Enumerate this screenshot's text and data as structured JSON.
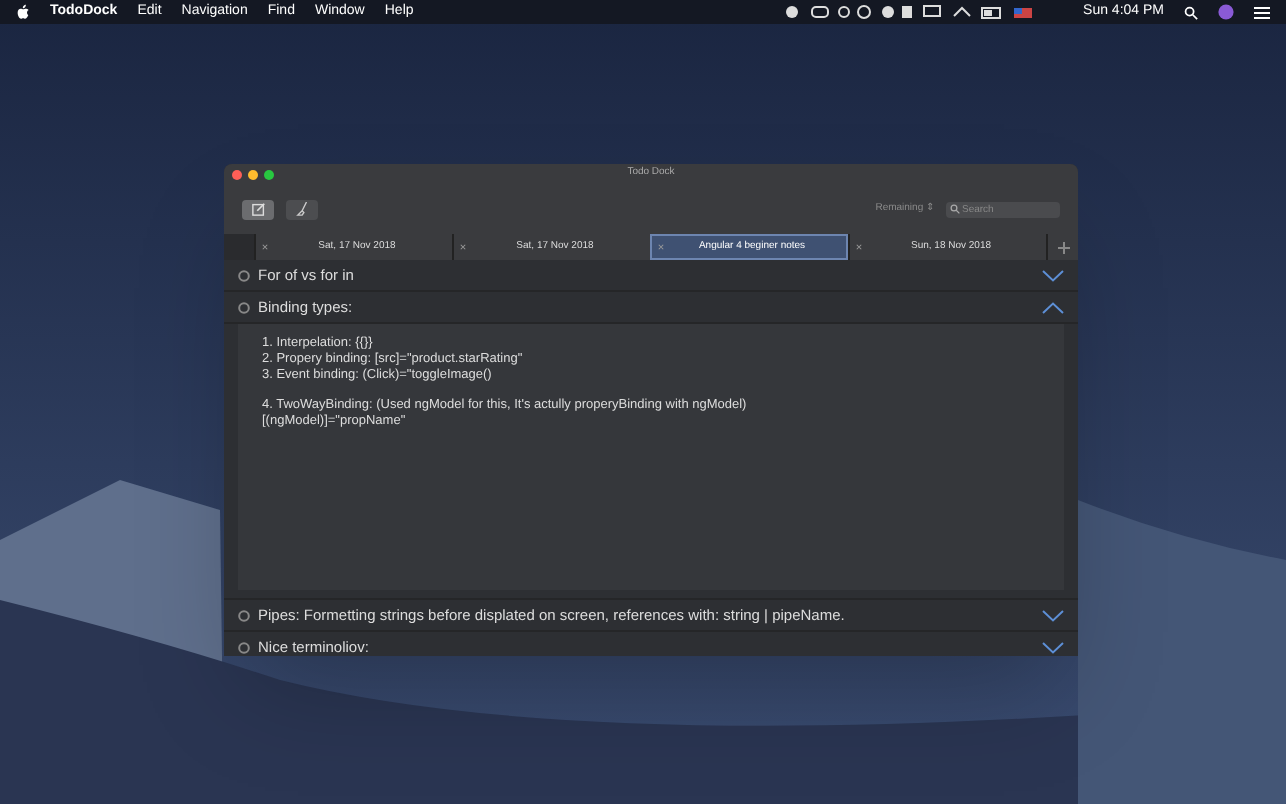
{
  "menu_bar": {
    "app_name": "TodoDock",
    "menus": [
      "Edit",
      "Navigation",
      "Find",
      "Window",
      "Help"
    ],
    "clock": "Sun 4:04 PM"
  },
  "window": {
    "title": "Todo Dock"
  },
  "toolbar": {
    "sort": "Remaining",
    "sort_arrows": "⇕",
    "search": {
      "placeholder": "Search"
    }
  },
  "tabs": [
    {
      "label": "Sat, 17 Nov 2018",
      "selected": false
    },
    {
      "label": "Sat, 17 Nov 2018",
      "selected": false
    },
    {
      "label": "Angular 4 beginer notes",
      "selected": true
    },
    {
      "label": "Sun, 18 Nov 2018",
      "selected": false
    }
  ],
  "items": [
    {
      "title": "For of vs for in",
      "expanded": false
    },
    {
      "title": "Binding types:",
      "expanded": true,
      "note": [
        [
          "1. Interpelation: {{}}",
          "2. Propery binding: [src]=\"product.starRating\"",
          "3. Event binding: (Click)=\"toggleImage()"
        ],
        [
          "4. TwoWayBinding: (Used ngModel for this, It's actully properyBinding with ngModel)",
          "[(ngModel)]=\"propName\""
        ]
      ]
    },
    {
      "title": "Pipes: Formetting strings before displated on screen, references with: string | pipeName.",
      "expanded": false
    },
    {
      "title": "Nice terminoliov:",
      "expanded": false
    }
  ]
}
